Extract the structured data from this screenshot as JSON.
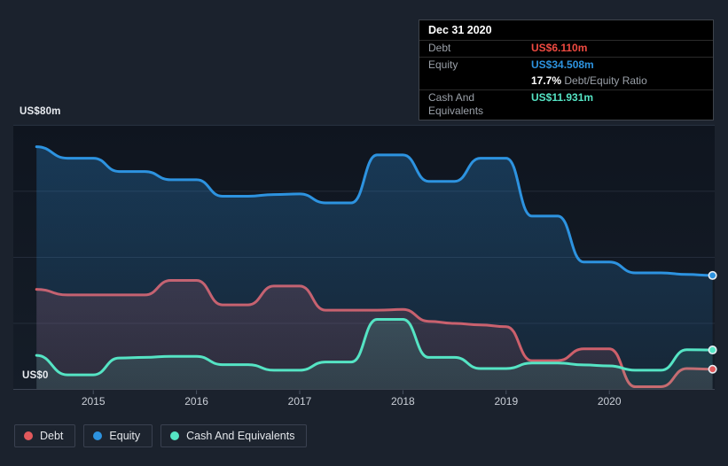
{
  "axes": {
    "y_top_label": "US$80m",
    "y_bottom_label": "US$0",
    "x_labels": [
      "2015",
      "2016",
      "2017",
      "2018",
      "2019",
      "2020"
    ]
  },
  "tooltip": {
    "date": "Dec 31 2020",
    "debt_label": "Debt",
    "debt_value": "US$6.110m",
    "equity_label": "Equity",
    "equity_value": "US$34.508m",
    "ratio_value": "17.7%",
    "ratio_label": "Debt/Equity Ratio",
    "cash_label": "Cash And Equivalents",
    "cash_value": "US$11.931m"
  },
  "legend": {
    "items": [
      {
        "label": "Debt",
        "color": "#e2595c"
      },
      {
        "label": "Equity",
        "color": "#2d93e0"
      },
      {
        "label": "Cash And Equivalents",
        "color": "#55e4c4"
      }
    ]
  },
  "chart_data": {
    "type": "area",
    "y_unit": "US$m",
    "ylim": [
      0,
      80
    ],
    "gridline_values": [
      80,
      60,
      40,
      20,
      0
    ],
    "legend_position": "bottom-left",
    "hover_point": "Dec 31 2020",
    "x": [
      2014.45,
      2014.75,
      2015.0,
      2015.25,
      2015.5,
      2015.75,
      2016.0,
      2016.25,
      2016.5,
      2016.75,
      2017.0,
      2017.25,
      2017.5,
      2017.75,
      2018.0,
      2018.25,
      2018.5,
      2018.75,
      2019.0,
      2019.25,
      2019.5,
      2019.75,
      2020.0,
      2020.25,
      2020.5,
      2020.75,
      2021.0
    ],
    "series": [
      {
        "name": "Debt",
        "color": "#e2595c",
        "values": [
          30.3,
          28.6,
          28.6,
          28.6,
          28.6,
          33.0,
          33.0,
          25.6,
          25.6,
          31.3,
          31.3,
          24.0,
          24.0,
          24.0,
          24.2,
          20.6,
          20.0,
          19.5,
          19.0,
          8.7,
          8.7,
          12.3,
          12.3,
          0.8,
          0.8,
          6.3,
          6.11
        ]
      },
      {
        "name": "Equity",
        "color": "#2d93e0",
        "values": [
          73.5,
          70.0,
          70.0,
          66.0,
          66.0,
          63.5,
          63.5,
          58.5,
          58.5,
          59.0,
          59.2,
          56.5,
          56.5,
          71.0,
          71.0,
          63.0,
          63.0,
          70.0,
          70.0,
          52.5,
          52.5,
          38.6,
          38.6,
          35.3,
          35.3,
          34.8,
          34.508
        ]
      },
      {
        "name": "Cash And Equivalents",
        "color": "#55e4c4",
        "values": [
          10.3,
          4.4,
          4.4,
          9.5,
          9.7,
          10.0,
          10.0,
          7.5,
          7.5,
          5.8,
          5.8,
          8.3,
          8.3,
          21.2,
          21.2,
          9.7,
          9.7,
          6.3,
          6.3,
          8.0,
          8.0,
          7.4,
          7.1,
          5.8,
          5.8,
          12.0,
          11.931
        ]
      }
    ]
  }
}
